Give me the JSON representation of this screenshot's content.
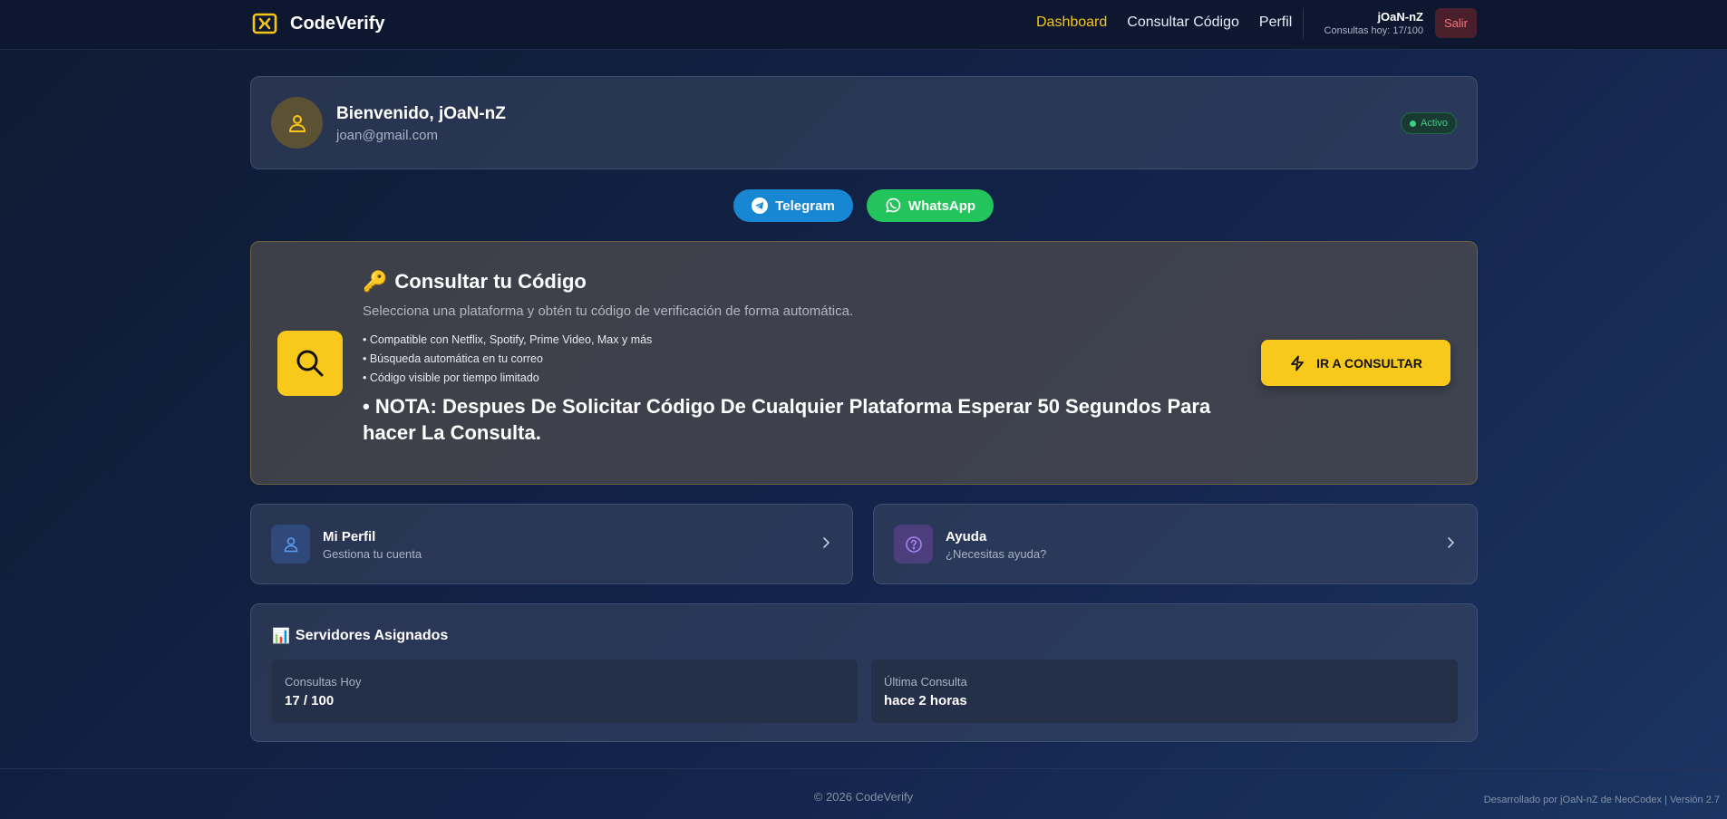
{
  "nav": {
    "brand": "CodeVerify",
    "links": [
      "Dashboard",
      "Consultar Código",
      "Perfil"
    ],
    "active": "Dashboard",
    "user_name": "jOaN-nZ",
    "quota": "Consultas hoy: 17/100",
    "logout": "Salir"
  },
  "welcome": {
    "title": "Bienvenido, jOaN-nZ",
    "email": "joan@gmail.com",
    "status": "Activo"
  },
  "social": {
    "telegram": "Telegram",
    "whatsapp": "WhatsApp"
  },
  "consult": {
    "emoji": "🔑",
    "title": "Consultar tu Código",
    "subtitle": "Selecciona una plataforma y obtén tu código de verificación de forma automática.",
    "features": [
      "• Compatible con Netflix, Spotify, Prime Video, Max y más",
      "• Búsqueda automática en tu correo",
      "• Código visible por tiempo limitado"
    ],
    "note": "• NOTA: Despues De Solicitar Código De Cualquier Plataforma Esperar 50 Segundos Para hacer La Consulta.",
    "button": "IR A CONSULTAR"
  },
  "cards": {
    "profile_title": "Mi Perfil",
    "profile_sub": "Gestiona tu cuenta",
    "help_title": "Ayuda",
    "help_sub": "¿Necesitas ayuda?"
  },
  "servers": {
    "emoji": "📊",
    "title": "Servidores Asignados",
    "today_label": "Consultas Hoy",
    "today_value": "17 / 100",
    "last_label": "Última Consulta",
    "last_value": "hace 2 horas"
  },
  "footer": {
    "copyright": "© 2026 CodeVerify",
    "credits": "Desarrollado por jOaN-nZ de NeoCodex | Versión 2.7"
  },
  "colors": {
    "accent": "#f6c518",
    "telegram": "#1787d4",
    "whatsapp": "#23c45c",
    "status": "#3ccf7e"
  }
}
